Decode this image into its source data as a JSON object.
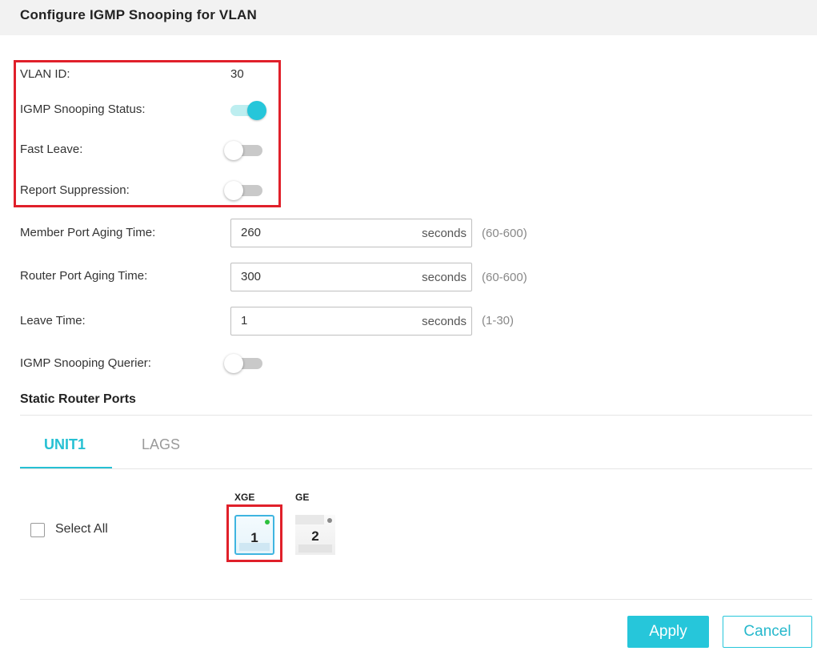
{
  "header": {
    "title": "Configure IGMP Snooping for VLAN"
  },
  "form": {
    "vlan_id": {
      "label": "VLAN ID:",
      "value": "30"
    },
    "igmp_status": {
      "label": "IGMP Snooping Status:",
      "on": true
    },
    "fast_leave": {
      "label": "Fast Leave:",
      "on": false
    },
    "report_suppression": {
      "label": "Report Suppression:",
      "on": false
    },
    "member_aging": {
      "label": "Member Port Aging Time:",
      "value": "260",
      "unit": "seconds",
      "range": "(60-600)"
    },
    "router_aging": {
      "label": "Router Port Aging Time:",
      "value": "300",
      "unit": "seconds",
      "range": "(60-600)"
    },
    "leave_time": {
      "label": "Leave Time:",
      "value": "1",
      "unit": "seconds",
      "range": "(1-30)"
    },
    "querier": {
      "label": "IGMP Snooping Querier:",
      "on": false
    }
  },
  "static_router_ports": {
    "title": "Static Router Ports",
    "tabs": [
      {
        "label": "UNIT1",
        "active": true
      },
      {
        "label": "LAGS",
        "active": false
      }
    ],
    "select_all_label": "Select All",
    "select_all_checked": false,
    "groups": [
      {
        "label": "XGE",
        "ports": [
          {
            "number": "1",
            "selected": true,
            "link_color": "#2cc13e"
          }
        ]
      },
      {
        "label": "GE",
        "ports": [
          {
            "number": "2",
            "selected": false,
            "link_color": "#8a8a8a"
          }
        ]
      }
    ]
  },
  "buttons": {
    "apply": "Apply",
    "cancel": "Cancel"
  },
  "colors": {
    "accent": "#26c6da",
    "highlight": "#e0202a"
  }
}
